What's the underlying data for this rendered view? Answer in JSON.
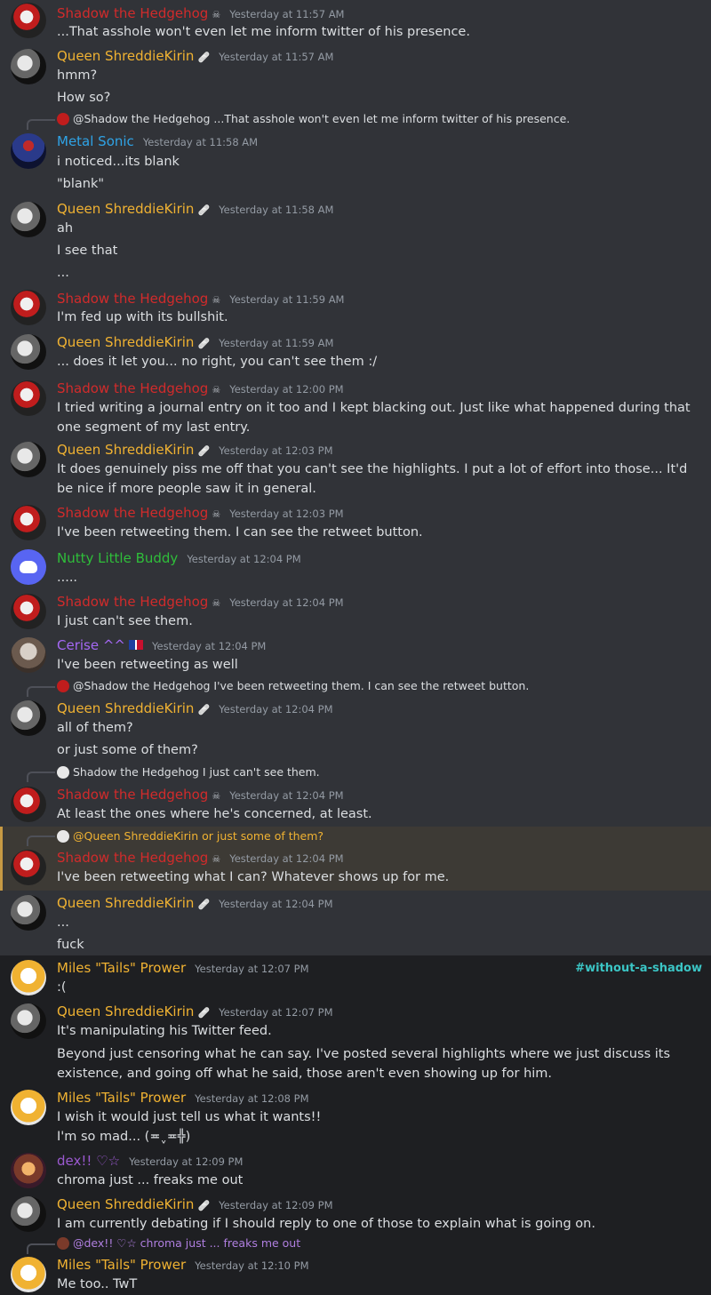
{
  "channel": "#without-a-shadow",
  "colors": {
    "shadow": "#d12b2b",
    "queen": "#f0b232",
    "metal": "#2fa3e6",
    "nutty": "#2fbe3a",
    "cerise": "#a568f5",
    "dex": "#9b59d0",
    "tails": "#f0b232",
    "channel": "#3bc5c5",
    "highlight": "#c79a43"
  },
  "users": {
    "shadow": "Shadow the Hedgehog",
    "queen": "Queen ShreddieKirin",
    "metal": "Metal Sonic",
    "nutty": "Nutty Little Buddy",
    "cerise": "Cerise ^^",
    "dex": "dex!! ♡☆",
    "tails": "Miles \"Tails\" Prower"
  },
  "messages": [
    {
      "ts": "Yesterday at 11:57 AM",
      "lines": [
        "...That asshole won't even let me inform twitter of his presence."
      ]
    },
    {
      "ts": "Yesterday at 11:57 AM",
      "lines": [
        "hmm?",
        "How so?"
      ]
    },
    {
      "reply": "@Shadow the Hedgehog ...That asshole won't even let me inform twitter of his presence.",
      "ts": "Yesterday at 11:58 AM",
      "lines": [
        "i noticed...its blank",
        "\"blank\""
      ]
    },
    {
      "ts": "Yesterday at 11:58 AM",
      "lines": [
        "ah",
        "I see that",
        "..."
      ]
    },
    {
      "ts": "Yesterday at 11:59 AM",
      "lines": [
        "I'm fed up with its bullshit."
      ]
    },
    {
      "ts": "Yesterday at 11:59 AM",
      "lines": [
        "... does it let you... no right, you can't see them :/"
      ]
    },
    {
      "ts": "Yesterday at 12:00 PM",
      "lines": [
        "I tried writing a journal entry on it too and I kept blacking out. Just like what happened during that one segment of my last entry."
      ]
    },
    {
      "ts": "Yesterday at 12:03 PM",
      "lines": [
        "It does genuinely piss me off that you can't see the highlights. I put a lot of effort into those... It'd be nice if more people saw it in general."
      ]
    },
    {
      "ts": "Yesterday at 12:03 PM",
      "lines": [
        "I've been retweeting them. I can see the retweet button."
      ]
    },
    {
      "ts": "Yesterday at 12:04 PM",
      "lines": [
        "....."
      ]
    },
    {
      "ts": "Yesterday at 12:04 PM",
      "lines": [
        "I just can't see them."
      ]
    },
    {
      "ts": "Yesterday at 12:04 PM",
      "lines": [
        "I've been retweeting as well"
      ]
    },
    {
      "reply": "@Shadow the Hedgehog I've been retweeting them. I can see the retweet button.",
      "ts": "Yesterday at 12:04 PM",
      "lines": [
        "all of them?",
        "or just some of them?"
      ]
    },
    {
      "reply": "Shadow the Hedgehog I just can't see them.",
      "ts": "Yesterday at 12:04 PM",
      "lines": [
        "At least the ones where he's concerned, at least."
      ]
    },
    {
      "reply": "@Queen ShreddieKirin or just some of them?",
      "ts": "Yesterday at 12:04 PM",
      "lines": [
        "I've been retweeting what I can? Whatever shows up for me."
      ]
    },
    {
      "ts": "Yesterday at 12:04 PM",
      "lines": [
        "...",
        "fuck"
      ]
    },
    {
      "ts": "Yesterday at 12:07 PM",
      "lines": [
        ":("
      ]
    },
    {
      "ts": "Yesterday at 12:07 PM",
      "lines": [
        "It's manipulating his Twitter feed.",
        "Beyond just censoring what he can say. I've posted several highlights where we just discuss its existence, and going off what he said, those aren't even showing up for him."
      ]
    },
    {
      "ts": "Yesterday at 12:08 PM",
      "lines": [
        "I wish it would just tell us what it wants!!",
        "I'm so mad... (≖ˬ≖╬)"
      ]
    },
    {
      "ts": "Yesterday at 12:09 PM",
      "lines": [
        "chroma just ... freaks me out"
      ]
    },
    {
      "ts": "Yesterday at 12:09 PM",
      "lines": [
        "I am currently debating if I should reply to one of those to explain what is going on."
      ]
    },
    {
      "reply": "@dex!! ♡☆ chroma just ... freaks me out",
      "ts": "Yesterday at 12:10 PM",
      "lines": [
        "Me too.. TwT"
      ]
    }
  ]
}
